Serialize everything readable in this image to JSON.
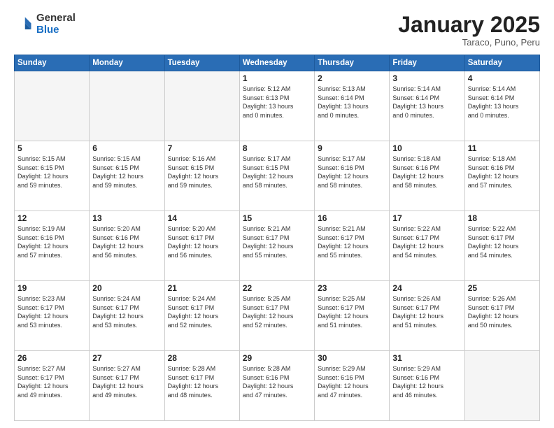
{
  "logo": {
    "general": "General",
    "blue": "Blue"
  },
  "header": {
    "month": "January 2025",
    "location": "Taraco, Puno, Peru"
  },
  "days_of_week": [
    "Sunday",
    "Monday",
    "Tuesday",
    "Wednesday",
    "Thursday",
    "Friday",
    "Saturday"
  ],
  "weeks": [
    [
      {
        "day": "",
        "info": ""
      },
      {
        "day": "",
        "info": ""
      },
      {
        "day": "",
        "info": ""
      },
      {
        "day": "1",
        "info": "Sunrise: 5:12 AM\nSunset: 6:13 PM\nDaylight: 13 hours\nand 0 minutes."
      },
      {
        "day": "2",
        "info": "Sunrise: 5:13 AM\nSunset: 6:14 PM\nDaylight: 13 hours\nand 0 minutes."
      },
      {
        "day": "3",
        "info": "Sunrise: 5:14 AM\nSunset: 6:14 PM\nDaylight: 13 hours\nand 0 minutes."
      },
      {
        "day": "4",
        "info": "Sunrise: 5:14 AM\nSunset: 6:14 PM\nDaylight: 13 hours\nand 0 minutes."
      }
    ],
    [
      {
        "day": "5",
        "info": "Sunrise: 5:15 AM\nSunset: 6:15 PM\nDaylight: 12 hours\nand 59 minutes."
      },
      {
        "day": "6",
        "info": "Sunrise: 5:15 AM\nSunset: 6:15 PM\nDaylight: 12 hours\nand 59 minutes."
      },
      {
        "day": "7",
        "info": "Sunrise: 5:16 AM\nSunset: 6:15 PM\nDaylight: 12 hours\nand 59 minutes."
      },
      {
        "day": "8",
        "info": "Sunrise: 5:17 AM\nSunset: 6:15 PM\nDaylight: 12 hours\nand 58 minutes."
      },
      {
        "day": "9",
        "info": "Sunrise: 5:17 AM\nSunset: 6:16 PM\nDaylight: 12 hours\nand 58 minutes."
      },
      {
        "day": "10",
        "info": "Sunrise: 5:18 AM\nSunset: 6:16 PM\nDaylight: 12 hours\nand 58 minutes."
      },
      {
        "day": "11",
        "info": "Sunrise: 5:18 AM\nSunset: 6:16 PM\nDaylight: 12 hours\nand 57 minutes."
      }
    ],
    [
      {
        "day": "12",
        "info": "Sunrise: 5:19 AM\nSunset: 6:16 PM\nDaylight: 12 hours\nand 57 minutes."
      },
      {
        "day": "13",
        "info": "Sunrise: 5:20 AM\nSunset: 6:16 PM\nDaylight: 12 hours\nand 56 minutes."
      },
      {
        "day": "14",
        "info": "Sunrise: 5:20 AM\nSunset: 6:17 PM\nDaylight: 12 hours\nand 56 minutes."
      },
      {
        "day": "15",
        "info": "Sunrise: 5:21 AM\nSunset: 6:17 PM\nDaylight: 12 hours\nand 55 minutes."
      },
      {
        "day": "16",
        "info": "Sunrise: 5:21 AM\nSunset: 6:17 PM\nDaylight: 12 hours\nand 55 minutes."
      },
      {
        "day": "17",
        "info": "Sunrise: 5:22 AM\nSunset: 6:17 PM\nDaylight: 12 hours\nand 54 minutes."
      },
      {
        "day": "18",
        "info": "Sunrise: 5:22 AM\nSunset: 6:17 PM\nDaylight: 12 hours\nand 54 minutes."
      }
    ],
    [
      {
        "day": "19",
        "info": "Sunrise: 5:23 AM\nSunset: 6:17 PM\nDaylight: 12 hours\nand 53 minutes."
      },
      {
        "day": "20",
        "info": "Sunrise: 5:24 AM\nSunset: 6:17 PM\nDaylight: 12 hours\nand 53 minutes."
      },
      {
        "day": "21",
        "info": "Sunrise: 5:24 AM\nSunset: 6:17 PM\nDaylight: 12 hours\nand 52 minutes."
      },
      {
        "day": "22",
        "info": "Sunrise: 5:25 AM\nSunset: 6:17 PM\nDaylight: 12 hours\nand 52 minutes."
      },
      {
        "day": "23",
        "info": "Sunrise: 5:25 AM\nSunset: 6:17 PM\nDaylight: 12 hours\nand 51 minutes."
      },
      {
        "day": "24",
        "info": "Sunrise: 5:26 AM\nSunset: 6:17 PM\nDaylight: 12 hours\nand 51 minutes."
      },
      {
        "day": "25",
        "info": "Sunrise: 5:26 AM\nSunset: 6:17 PM\nDaylight: 12 hours\nand 50 minutes."
      }
    ],
    [
      {
        "day": "26",
        "info": "Sunrise: 5:27 AM\nSunset: 6:17 PM\nDaylight: 12 hours\nand 49 minutes."
      },
      {
        "day": "27",
        "info": "Sunrise: 5:27 AM\nSunset: 6:17 PM\nDaylight: 12 hours\nand 49 minutes."
      },
      {
        "day": "28",
        "info": "Sunrise: 5:28 AM\nSunset: 6:17 PM\nDaylight: 12 hours\nand 48 minutes."
      },
      {
        "day": "29",
        "info": "Sunrise: 5:28 AM\nSunset: 6:16 PM\nDaylight: 12 hours\nand 47 minutes."
      },
      {
        "day": "30",
        "info": "Sunrise: 5:29 AM\nSunset: 6:16 PM\nDaylight: 12 hours\nand 47 minutes."
      },
      {
        "day": "31",
        "info": "Sunrise: 5:29 AM\nSunset: 6:16 PM\nDaylight: 12 hours\nand 46 minutes."
      },
      {
        "day": "",
        "info": ""
      }
    ]
  ]
}
